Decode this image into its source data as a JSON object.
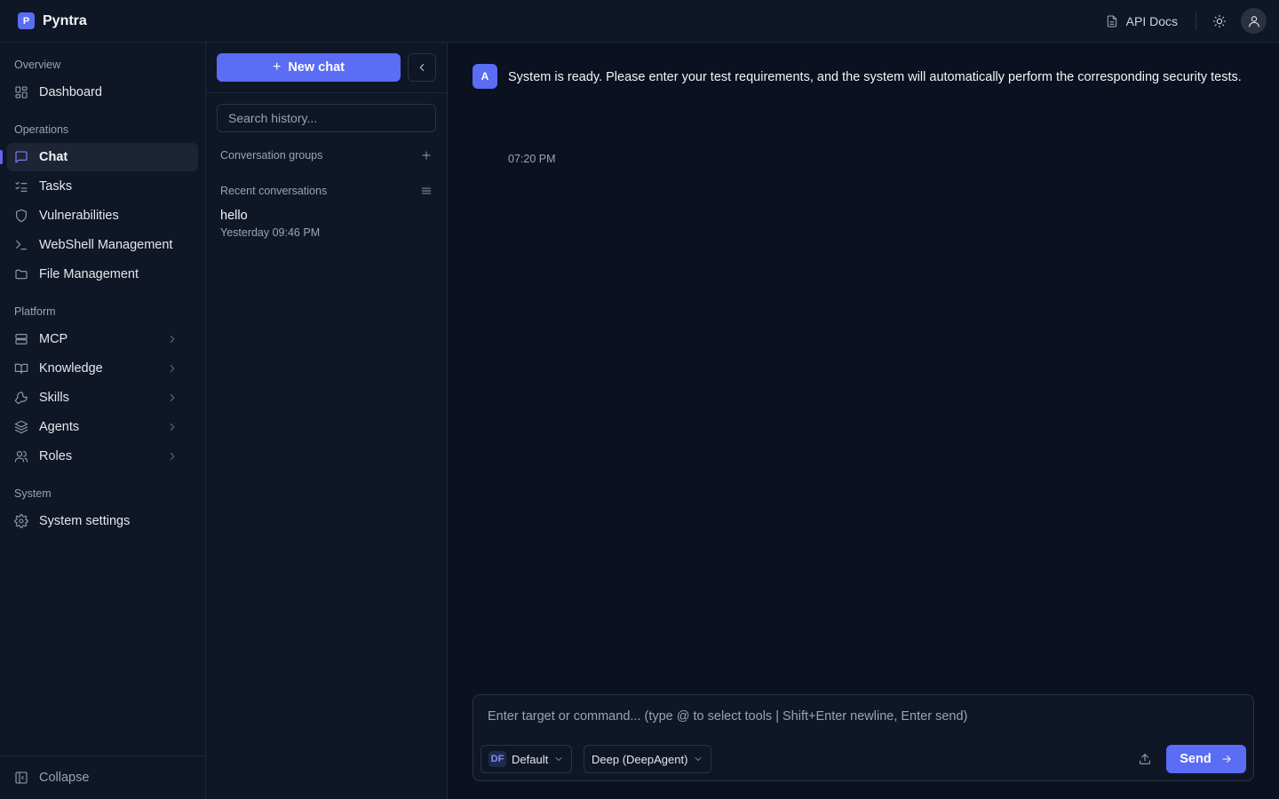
{
  "topbar": {
    "brand_logo": "P",
    "brand_name": "Pyntra",
    "api_docs_label": "API Docs"
  },
  "sidebar": {
    "sections": {
      "overview": "Overview",
      "operations": "Operations",
      "platform": "Platform",
      "system": "System"
    },
    "items": {
      "dashboard": "Dashboard",
      "chat": "Chat",
      "tasks": "Tasks",
      "vulnerabilities": "Vulnerabilities",
      "webshell": "WebShell Management",
      "files": "File Management",
      "mcp": "MCP",
      "knowledge": "Knowledge",
      "skills": "Skills",
      "agents": "Agents",
      "roles": "Roles",
      "settings": "System settings"
    },
    "active_item": "chat",
    "collapse_label": "Collapse"
  },
  "history": {
    "new_chat_label": "New chat",
    "search_placeholder": "Search history...",
    "groups_label": "Conversation groups",
    "recent_label": "Recent conversations",
    "conversations": [
      {
        "title": "hello",
        "time": "Yesterday 09:46 PM"
      }
    ]
  },
  "chat": {
    "messages": [
      {
        "avatar": "A",
        "text": "System is ready. Please enter your test requirements, and the system will automatically perform the corresponding security tests.",
        "time": "07:20 PM"
      }
    ],
    "composer": {
      "placeholder": "Enter target or command... (type @ to select tools | Shift+Enter newline, Enter send)",
      "role_badge": "DF",
      "role_label": "Default",
      "mode_label": "Deep (DeepAgent)",
      "send_label": "Send"
    }
  },
  "colors": {
    "accent": "#5b6cf5",
    "background": "#0b1120",
    "panel": "#0f1626",
    "border": "#1f2937"
  },
  "icons": {
    "api_docs": "document-icon",
    "theme": "sun-icon",
    "account": "user-icon",
    "dashboard": "grid-icon",
    "chat": "message-square-icon",
    "tasks": "list-checks-icon",
    "vulnerabilities": "shield-icon",
    "webshell": "terminal-icon",
    "files": "folder-icon",
    "mcp": "server-icon",
    "knowledge": "book-icon",
    "skills": "wrench-icon",
    "agents": "layers-icon",
    "roles": "users-icon",
    "settings": "gear-icon",
    "collapse": "sidebar-collapse-icon",
    "upload": "upload-icon",
    "send": "arrow-right-icon"
  }
}
